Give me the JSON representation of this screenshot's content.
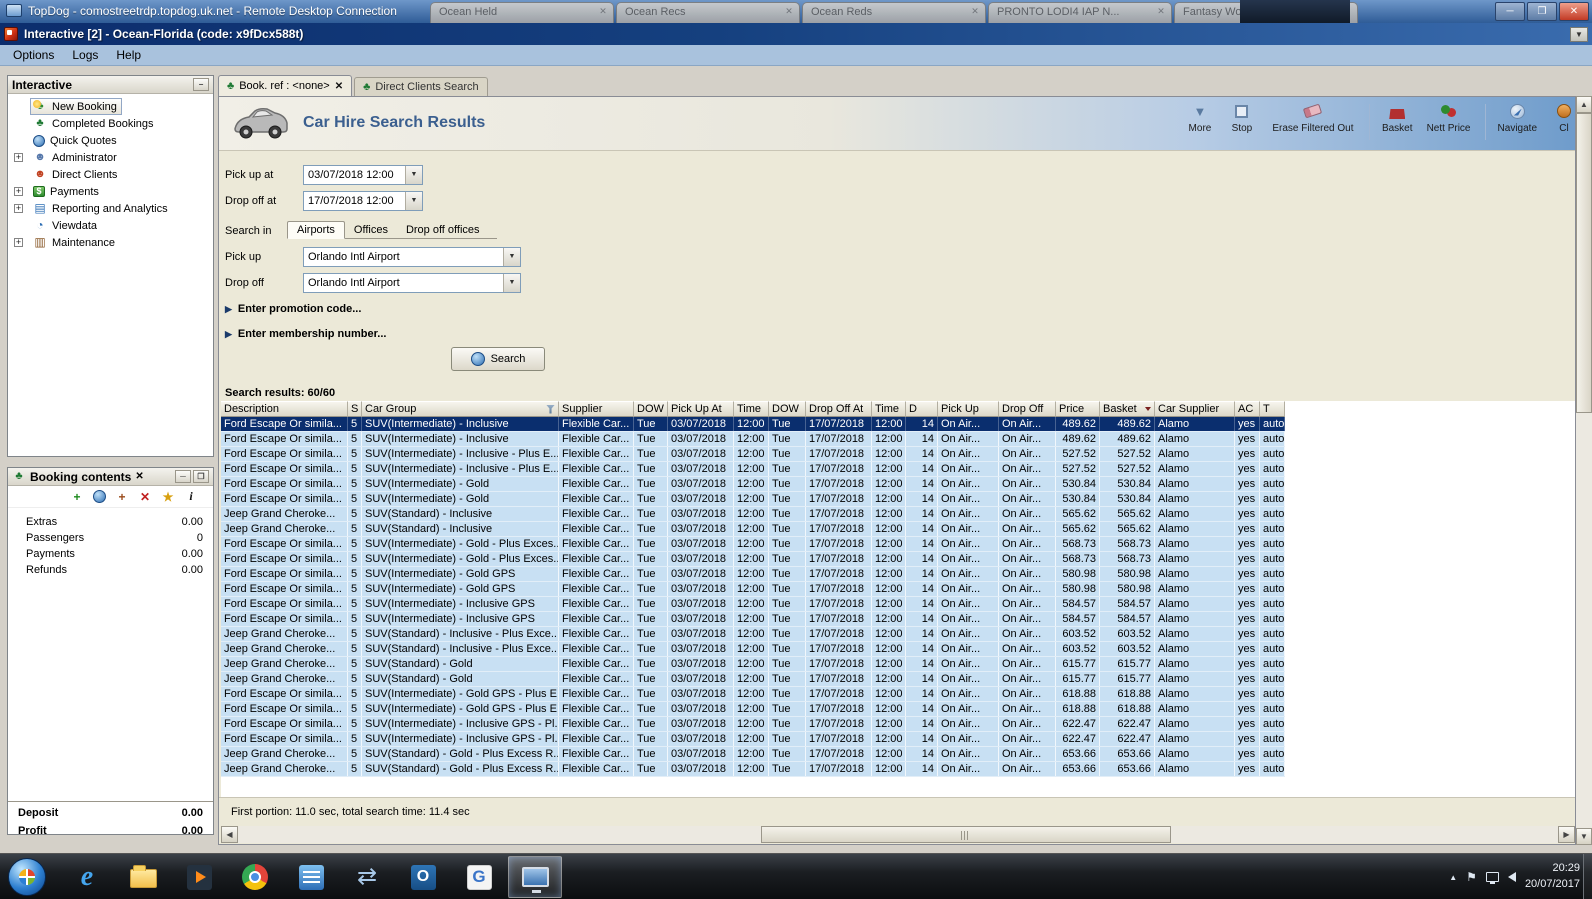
{
  "icons": {
    "close": "✕",
    "dropdown": "▼",
    "up": "▲",
    "down": "▼",
    "left": "◀",
    "right": "▶",
    "minimize": "─",
    "restore": "❐",
    "plus": "+",
    "minus": "−",
    "info": "i",
    "expander": "▶",
    "palm": "♣",
    "person": "☻",
    "clients": "☻",
    "money": "$",
    "report": "▤",
    "viewdata": "◔",
    "maintenance": "▥",
    "star": "★",
    "ie": "e",
    "sync": "⇄",
    "outlook": "O",
    "g": "G",
    "flag": "⚑"
  },
  "rdp_bar": {
    "title": "TopDog - comostreetrdp.topdog.uk.net - Remote Desktop Connection",
    "background_tabs": [
      "Ocean Held",
      "Ocean Recs",
      "Ocean Reds",
      "PRONTO LODI4 IAP N...",
      "Fantasy World Beach S..."
    ]
  },
  "app": {
    "title": "Interactive [2] - Ocean-Florida (code: x9fDcx588t)",
    "menu": [
      "Options",
      "Logs",
      "Help"
    ]
  },
  "sidebar": {
    "title": "Interactive",
    "items": [
      {
        "label": "New Booking"
      },
      {
        "label": "Completed Bookings"
      },
      {
        "label": "Quick Quotes"
      },
      {
        "label": "Administrator"
      },
      {
        "label": "Direct Clients"
      },
      {
        "label": "Payments"
      },
      {
        "label": "Reporting and Analytics"
      },
      {
        "label": "Viewdata"
      },
      {
        "label": "Maintenance"
      }
    ]
  },
  "booking_contents": {
    "title": "Booking contents",
    "rows": [
      {
        "label": "Extras",
        "value": "0.00"
      },
      {
        "label": "Passengers",
        "value": "0"
      },
      {
        "label": "Payments",
        "value": "0.00"
      },
      {
        "label": "Refunds",
        "value": "0.00"
      }
    ],
    "totals": [
      {
        "label": "Deposit",
        "value": "0.00"
      },
      {
        "label": "Profit",
        "value": "0.00"
      }
    ]
  },
  "tabs": [
    {
      "label": "Book. ref : <none>"
    },
    {
      "label": "Direct Clients Search"
    }
  ],
  "header": {
    "title": "Car Hire Search Results",
    "toolbar": [
      {
        "label": "More"
      },
      {
        "label": "Stop"
      },
      {
        "label": "Erase Filtered Out"
      },
      {
        "label": "Basket"
      },
      {
        "label": "Nett Price"
      },
      {
        "label": "Navigate"
      },
      {
        "label": "Cl"
      }
    ]
  },
  "form": {
    "pick_up_at": {
      "label": "Pick up at",
      "value": "03/07/2018 12:00"
    },
    "drop_off_at": {
      "label": "Drop off at",
      "value": "17/07/2018 12:00"
    },
    "search_in": {
      "label": "Search in",
      "options": [
        "Airports",
        "Offices",
        "Drop off offices"
      ],
      "selected": "Airports"
    },
    "pick_up": {
      "label": "Pick up",
      "value": "Orlando Intl Airport"
    },
    "drop_off": {
      "label": "Drop off",
      "value": "Orlando Intl Airport"
    },
    "promotion": "Enter promotion code...",
    "membership": "Enter membership number...",
    "search_button": "Search"
  },
  "results": {
    "summary": "Search results: 60/60",
    "status": "First portion: 11.0 sec, total search time: 11.4 sec",
    "selected_row": 0,
    "columns": [
      "Description",
      "S",
      "Car Group",
      "Supplier",
      "DOW",
      "Pick Up At",
      "Time",
      "DOW",
      "Drop Off At",
      "Time",
      "D",
      "Pick Up",
      "Drop Off",
      "Price",
      "Basket",
      "Car Supplier",
      "AC",
      "T"
    ],
    "rows": [
      [
        "Ford Escape Or simila...",
        "5",
        "SUV(Intermediate) - Inclusive",
        "Flexible Car...",
        "Tue",
        "03/07/2018",
        "12:00",
        "Tue",
        "17/07/2018",
        "12:00",
        "14",
        "On Air...",
        "On Air...",
        "489.62",
        "489.62",
        "Alamo",
        "yes",
        "auto"
      ],
      [
        "Ford Escape Or simila...",
        "5",
        "SUV(Intermediate) - Inclusive",
        "Flexible Car...",
        "Tue",
        "03/07/2018",
        "12:00",
        "Tue",
        "17/07/2018",
        "12:00",
        "14",
        "On Air...",
        "On Air...",
        "489.62",
        "489.62",
        "Alamo",
        "yes",
        "auto"
      ],
      [
        "Ford Escape Or simila...",
        "5",
        "SUV(Intermediate) - Inclusive - Plus E...",
        "Flexible Car...",
        "Tue",
        "03/07/2018",
        "12:00",
        "Tue",
        "17/07/2018",
        "12:00",
        "14",
        "On Air...",
        "On Air...",
        "527.52",
        "527.52",
        "Alamo",
        "yes",
        "auto"
      ],
      [
        "Ford Escape Or simila...",
        "5",
        "SUV(Intermediate) - Inclusive - Plus E...",
        "Flexible Car...",
        "Tue",
        "03/07/2018",
        "12:00",
        "Tue",
        "17/07/2018",
        "12:00",
        "14",
        "On Air...",
        "On Air...",
        "527.52",
        "527.52",
        "Alamo",
        "yes",
        "auto"
      ],
      [
        "Ford Escape Or simila...",
        "5",
        "SUV(Intermediate) - Gold",
        "Flexible Car...",
        "Tue",
        "03/07/2018",
        "12:00",
        "Tue",
        "17/07/2018",
        "12:00",
        "14",
        "On Air...",
        "On Air...",
        "530.84",
        "530.84",
        "Alamo",
        "yes",
        "auto"
      ],
      [
        "Ford Escape Or simila...",
        "5",
        "SUV(Intermediate) - Gold",
        "Flexible Car...",
        "Tue",
        "03/07/2018",
        "12:00",
        "Tue",
        "17/07/2018",
        "12:00",
        "14",
        "On Air...",
        "On Air...",
        "530.84",
        "530.84",
        "Alamo",
        "yes",
        "auto"
      ],
      [
        "Jeep Grand Cheroke...",
        "5",
        "SUV(Standard) - Inclusive",
        "Flexible Car...",
        "Tue",
        "03/07/2018",
        "12:00",
        "Tue",
        "17/07/2018",
        "12:00",
        "14",
        "On Air...",
        "On Air...",
        "565.62",
        "565.62",
        "Alamo",
        "yes",
        "auto"
      ],
      [
        "Jeep Grand Cheroke...",
        "5",
        "SUV(Standard) - Inclusive",
        "Flexible Car...",
        "Tue",
        "03/07/2018",
        "12:00",
        "Tue",
        "17/07/2018",
        "12:00",
        "14",
        "On Air...",
        "On Air...",
        "565.62",
        "565.62",
        "Alamo",
        "yes",
        "auto"
      ],
      [
        "Ford Escape Or simila...",
        "5",
        "SUV(Intermediate) - Gold - Plus Exces...",
        "Flexible Car...",
        "Tue",
        "03/07/2018",
        "12:00",
        "Tue",
        "17/07/2018",
        "12:00",
        "14",
        "On Air...",
        "On Air...",
        "568.73",
        "568.73",
        "Alamo",
        "yes",
        "auto"
      ],
      [
        "Ford Escape Or simila...",
        "5",
        "SUV(Intermediate) - Gold - Plus Exces...",
        "Flexible Car...",
        "Tue",
        "03/07/2018",
        "12:00",
        "Tue",
        "17/07/2018",
        "12:00",
        "14",
        "On Air...",
        "On Air...",
        "568.73",
        "568.73",
        "Alamo",
        "yes",
        "auto"
      ],
      [
        "Ford Escape Or simila...",
        "5",
        "SUV(Intermediate) - Gold GPS",
        "Flexible Car...",
        "Tue",
        "03/07/2018",
        "12:00",
        "Tue",
        "17/07/2018",
        "12:00",
        "14",
        "On Air...",
        "On Air...",
        "580.98",
        "580.98",
        "Alamo",
        "yes",
        "auto"
      ],
      [
        "Ford Escape Or simila...",
        "5",
        "SUV(Intermediate) - Gold GPS",
        "Flexible Car...",
        "Tue",
        "03/07/2018",
        "12:00",
        "Tue",
        "17/07/2018",
        "12:00",
        "14",
        "On Air...",
        "On Air...",
        "580.98",
        "580.98",
        "Alamo",
        "yes",
        "auto"
      ],
      [
        "Ford Escape Or simila...",
        "5",
        "SUV(Intermediate) - Inclusive GPS",
        "Flexible Car...",
        "Tue",
        "03/07/2018",
        "12:00",
        "Tue",
        "17/07/2018",
        "12:00",
        "14",
        "On Air...",
        "On Air...",
        "584.57",
        "584.57",
        "Alamo",
        "yes",
        "auto"
      ],
      [
        "Ford Escape Or simila...",
        "5",
        "SUV(Intermediate) - Inclusive GPS",
        "Flexible Car...",
        "Tue",
        "03/07/2018",
        "12:00",
        "Tue",
        "17/07/2018",
        "12:00",
        "14",
        "On Air...",
        "On Air...",
        "584.57",
        "584.57",
        "Alamo",
        "yes",
        "auto"
      ],
      [
        "Jeep Grand Cheroke...",
        "5",
        "SUV(Standard) - Inclusive - Plus Exce...",
        "Flexible Car...",
        "Tue",
        "03/07/2018",
        "12:00",
        "Tue",
        "17/07/2018",
        "12:00",
        "14",
        "On Air...",
        "On Air...",
        "603.52",
        "603.52",
        "Alamo",
        "yes",
        "auto"
      ],
      [
        "Jeep Grand Cheroke...",
        "5",
        "SUV(Standard) - Inclusive - Plus Exce...",
        "Flexible Car...",
        "Tue",
        "03/07/2018",
        "12:00",
        "Tue",
        "17/07/2018",
        "12:00",
        "14",
        "On Air...",
        "On Air...",
        "603.52",
        "603.52",
        "Alamo",
        "yes",
        "auto"
      ],
      [
        "Jeep Grand Cheroke...",
        "5",
        "SUV(Standard) - Gold",
        "Flexible Car...",
        "Tue",
        "03/07/2018",
        "12:00",
        "Tue",
        "17/07/2018",
        "12:00",
        "14",
        "On Air...",
        "On Air...",
        "615.77",
        "615.77",
        "Alamo",
        "yes",
        "auto"
      ],
      [
        "Jeep Grand Cheroke...",
        "5",
        "SUV(Standard) - Gold",
        "Flexible Car...",
        "Tue",
        "03/07/2018",
        "12:00",
        "Tue",
        "17/07/2018",
        "12:00",
        "14",
        "On Air...",
        "On Air...",
        "615.77",
        "615.77",
        "Alamo",
        "yes",
        "auto"
      ],
      [
        "Ford Escape Or simila...",
        "5",
        "SUV(Intermediate) - Gold GPS - Plus E...",
        "Flexible Car...",
        "Tue",
        "03/07/2018",
        "12:00",
        "Tue",
        "17/07/2018",
        "12:00",
        "14",
        "On Air...",
        "On Air...",
        "618.88",
        "618.88",
        "Alamo",
        "yes",
        "auto"
      ],
      [
        "Ford Escape Or simila...",
        "5",
        "SUV(Intermediate) - Gold GPS - Plus E...",
        "Flexible Car...",
        "Tue",
        "03/07/2018",
        "12:00",
        "Tue",
        "17/07/2018",
        "12:00",
        "14",
        "On Air...",
        "On Air...",
        "618.88",
        "618.88",
        "Alamo",
        "yes",
        "auto"
      ],
      [
        "Ford Escape Or simila...",
        "5",
        "SUV(Intermediate) - Inclusive GPS - Pl...",
        "Flexible Car...",
        "Tue",
        "03/07/2018",
        "12:00",
        "Tue",
        "17/07/2018",
        "12:00",
        "14",
        "On Air...",
        "On Air...",
        "622.47",
        "622.47",
        "Alamo",
        "yes",
        "auto"
      ],
      [
        "Ford Escape Or simila...",
        "5",
        "SUV(Intermediate) - Inclusive GPS - Pl...",
        "Flexible Car...",
        "Tue",
        "03/07/2018",
        "12:00",
        "Tue",
        "17/07/2018",
        "12:00",
        "14",
        "On Air...",
        "On Air...",
        "622.47",
        "622.47",
        "Alamo",
        "yes",
        "auto"
      ],
      [
        "Jeep Grand Cheroke...",
        "5",
        "SUV(Standard) - Gold - Plus Excess R...",
        "Flexible Car...",
        "Tue",
        "03/07/2018",
        "12:00",
        "Tue",
        "17/07/2018",
        "12:00",
        "14",
        "On Air...",
        "On Air...",
        "653.66",
        "653.66",
        "Alamo",
        "yes",
        "auto"
      ],
      [
        "Jeep Grand Cheroke...",
        "5",
        "SUV(Standard) - Gold - Plus Excess R...",
        "Flexible Car...",
        "Tue",
        "03/07/2018",
        "12:00",
        "Tue",
        "17/07/2018",
        "12:00",
        "14",
        "On Air...",
        "On Air...",
        "653.66",
        "653.66",
        "Alamo",
        "yes",
        "auto"
      ]
    ]
  },
  "taskbar": {
    "time": "20:29",
    "date": "20/07/2017"
  }
}
